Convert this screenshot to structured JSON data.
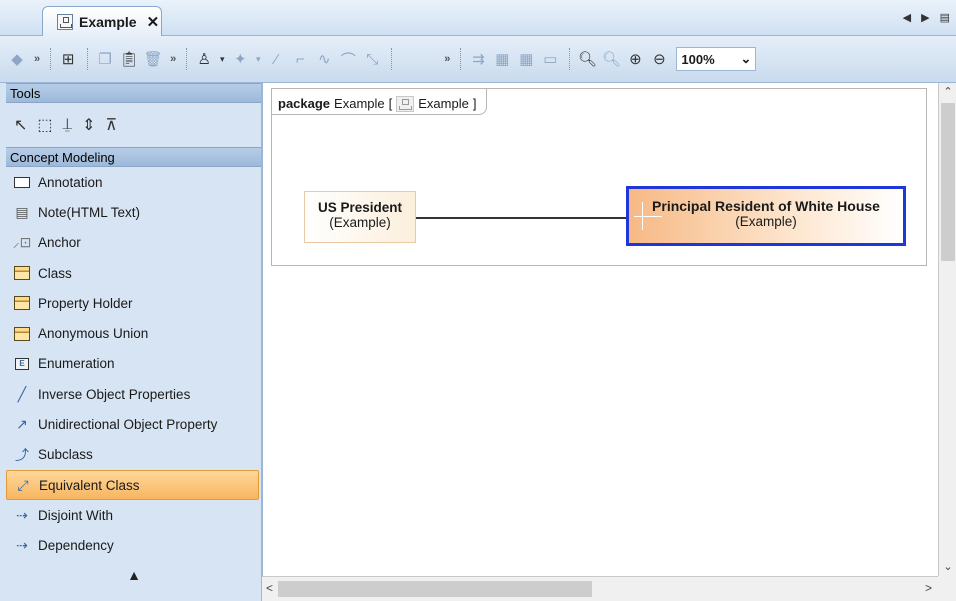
{
  "tab": {
    "label": "Example",
    "close": "✕"
  },
  "tab_nav": {
    "prev": "◀",
    "next": "▶",
    "menu": "▤"
  },
  "toolbar": {
    "more_symbol": "»",
    "zoom_value": "100%",
    "zoom_caret": "⌄"
  },
  "palette": {
    "tools_header": "Tools",
    "group_header": "Concept Modeling",
    "items": [
      {
        "label": "Annotation",
        "icon": "annotation-icon"
      },
      {
        "label": "Note(HTML Text)",
        "icon": "note-html-icon"
      },
      {
        "label": "Anchor",
        "icon": "anchor-icon"
      },
      {
        "label": "Class",
        "icon": "class-icon"
      },
      {
        "label": "Property Holder",
        "icon": "property-holder-icon"
      },
      {
        "label": "Anonymous Union",
        "icon": "anonymous-union-icon"
      },
      {
        "label": "Enumeration",
        "icon": "enumeration-icon"
      },
      {
        "label": "Inverse Object Properties",
        "icon": "inverse-line-icon"
      },
      {
        "label": "Unidirectional Object Property",
        "icon": "arrow-line-icon"
      },
      {
        "label": "Subclass",
        "icon": "subclass-icon"
      },
      {
        "label": "Equivalent Class",
        "icon": "equivalent-class-icon",
        "selected": true
      },
      {
        "label": "Disjoint With",
        "icon": "disjoint-icon"
      },
      {
        "label": "Dependency",
        "icon": "dependency-icon"
      }
    ],
    "collapse": "▲"
  },
  "diagram": {
    "frame_keyword": "package",
    "frame_name": "Example",
    "frame_open": "[",
    "frame_ref": "Example",
    "frame_close": "]",
    "nodes": [
      {
        "name": "US President",
        "owner": "(Example)"
      },
      {
        "name": "Principal Resident of White House",
        "owner": "(Example)"
      }
    ]
  },
  "scrollbars": {
    "up": "⌃",
    "down": "⌄",
    "left": "<",
    "right": ">"
  },
  "colors": {
    "selection_border": "#1f36d8",
    "palette_selected": "#f8b561",
    "panel_bg": "#d6e4f3"
  }
}
